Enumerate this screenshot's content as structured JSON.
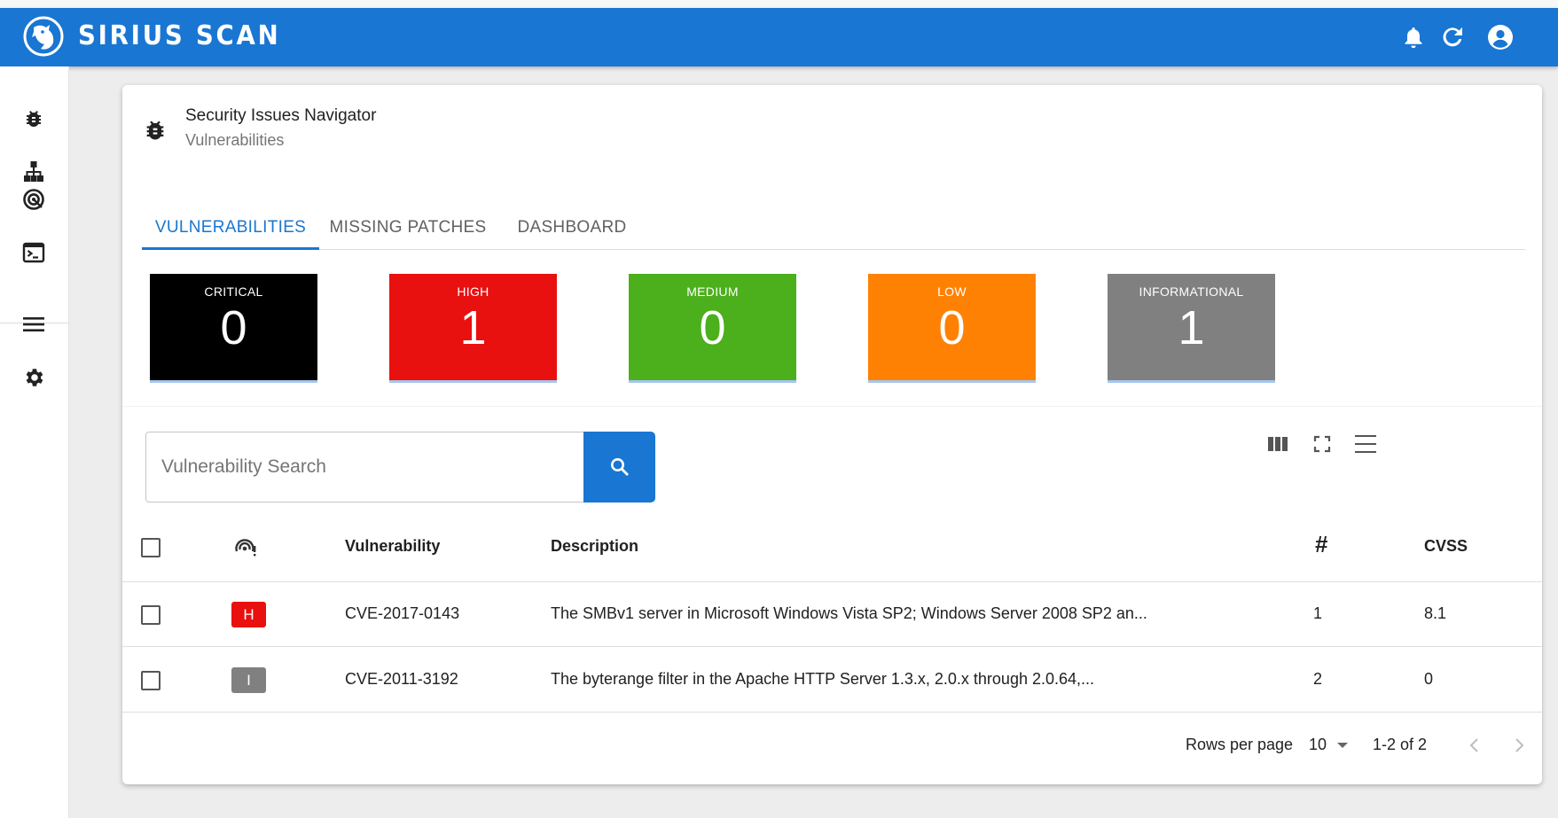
{
  "app": {
    "brand": "SIRIUS SCAN"
  },
  "topbar": {
    "icons": [
      "bell-icon",
      "refresh-icon",
      "account-circle-icon"
    ]
  },
  "sidebar": {
    "items": [
      "bug-icon",
      "sitemap-icon",
      "target-icon",
      "console-icon",
      "menu-icon",
      "gear-icon"
    ]
  },
  "header": {
    "title": "Security Issues Navigator",
    "subtitle": "Vulnerabilities"
  },
  "tabs": [
    {
      "label": "VULNERABILITIES",
      "active": true
    },
    {
      "label": "MISSING PATCHES",
      "active": false
    },
    {
      "label": "DASHBOARD",
      "active": false
    }
  ],
  "severity_cards": [
    {
      "label": "CRITICAL",
      "count": "0",
      "color": "#000000"
    },
    {
      "label": "HIGH",
      "count": "1",
      "color": "#e91010"
    },
    {
      "label": "MEDIUM",
      "count": "0",
      "color": "#4caf1c"
    },
    {
      "label": "LOW",
      "count": "0",
      "color": "#ff8104"
    },
    {
      "label": "INFORMATIONAL",
      "count": "1",
      "color": "#808080"
    }
  ],
  "search": {
    "placeholder": "Vulnerability Search"
  },
  "table": {
    "columns": [
      "Vulnerability",
      "Description",
      "#",
      "CVSS"
    ],
    "rows": [
      {
        "severity": "H",
        "severity_color": "#e91010",
        "id": "CVE-2017-0143",
        "description": "The SMBv1 server in Microsoft Windows Vista SP2; Windows Server 2008 SP2 an...",
        "count": "1",
        "cvss": "8.1"
      },
      {
        "severity": "I",
        "severity_color": "#808080",
        "id": "CVE-2011-3192",
        "description": "The byterange filter in the Apache HTTP Server 1.3.x, 2.0.x through 2.0.64,...",
        "count": "2",
        "cvss": "0"
      }
    ]
  },
  "pagination": {
    "rows_per_page_label": "Rows per page",
    "rows_per_page": "10",
    "range": "1-2 of 2"
  }
}
